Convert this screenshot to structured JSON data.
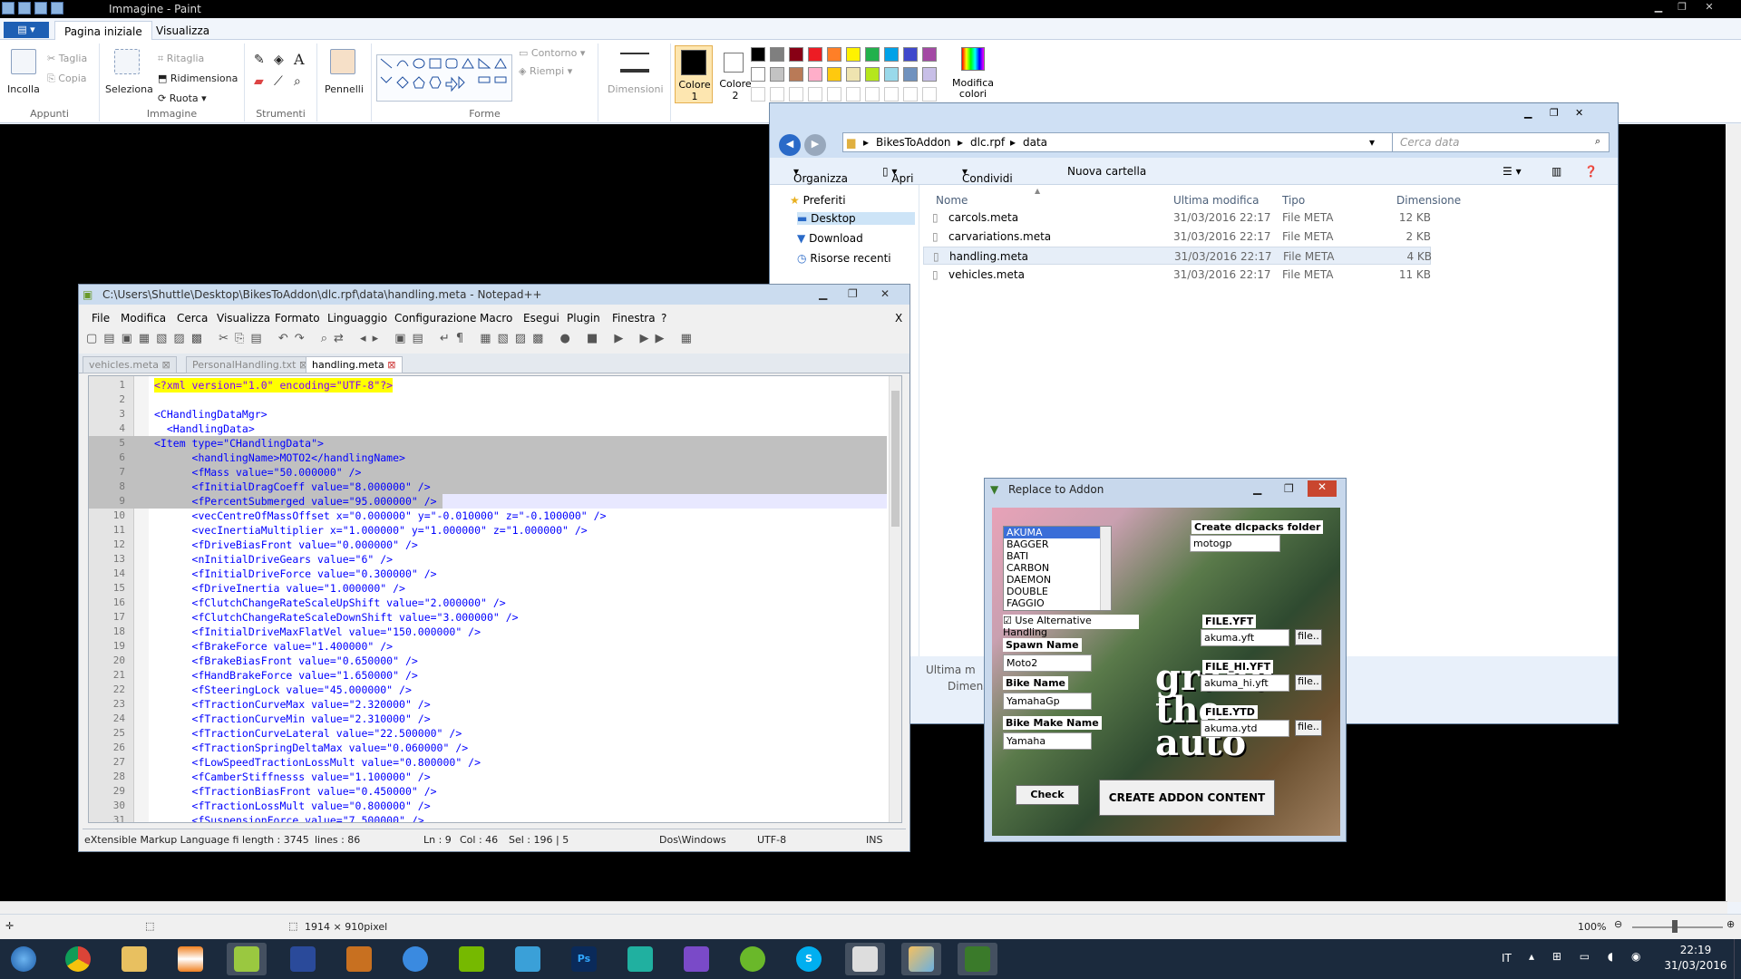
{
  "paint": {
    "title": "Immagine - Paint",
    "tabs": [
      "Pagina iniziale",
      "Visualizza"
    ],
    "groups": {
      "clipboard": {
        "label": "Appunti",
        "paste": "Incolla",
        "cut": "Taglia",
        "copy": "Copia"
      },
      "image": {
        "label": "Immagine",
        "select": "Seleziona",
        "crop": "Ritaglia",
        "resize": "Ridimensiona",
        "rotate": "Ruota"
      },
      "tools": {
        "label": "Strumenti"
      },
      "brushes": {
        "label": "Pennelli"
      },
      "shapes": {
        "label": "Forme",
        "outline": "Contorno",
        "fill": "Riempi"
      },
      "size": {
        "label": "Dimensioni"
      },
      "color1": "Colore 1",
      "color2": "Colore 2",
      "edit_colors": "Modifica colori"
    },
    "palette": [
      "#000000",
      "#7f7f7f",
      "#880015",
      "#ed1c24",
      "#ff7f27",
      "#fff200",
      "#22b14c",
      "#00a2e8",
      "#3f48cc",
      "#a349a4",
      "#ffffff",
      "#c3c3c3",
      "#b97a57",
      "#ffaec9",
      "#ffc90e",
      "#efe4b0",
      "#b5e61d",
      "#99d9ea",
      "#7092be",
      "#c8bfe7"
    ],
    "status": {
      "size": "1914 × 910pixel",
      "zoom": "100%"
    }
  },
  "explorer": {
    "path": [
      "BikesToAddon",
      "dlc.rpf",
      "data"
    ],
    "search_placeholder": "Cerca data",
    "toolbar": [
      "Organizza",
      "Apri",
      "Condividi con",
      "Nuova cartella"
    ],
    "nav": [
      "Preferiti",
      "Desktop",
      "Download",
      "Risorse recenti"
    ],
    "columns": [
      "Nome",
      "Ultima modifica",
      "Tipo",
      "Dimensione"
    ],
    "files": [
      {
        "name": "carcols.meta",
        "date": "31/03/2016 22:17",
        "type": "File META",
        "size": "12 KB"
      },
      {
        "name": "carvariations.meta",
        "date": "31/03/2016 22:17",
        "type": "File META",
        "size": "2 KB"
      },
      {
        "name": "handling.meta",
        "date": "31/03/2016 22:17",
        "type": "File META",
        "size": "4 KB"
      },
      {
        "name": "vehicles.meta",
        "date": "31/03/2016 22:17",
        "type": "File META",
        "size": "11 KB"
      }
    ],
    "details": [
      "Ultima m",
      "Dimensi"
    ]
  },
  "npp": {
    "title": "C:\\Users\\Shuttle\\Desktop\\BikesToAddon\\dlc.rpf\\data\\handling.meta - Notepad++",
    "menu": [
      "File",
      "Modifica",
      "Cerca",
      "Visualizza",
      "Formato",
      "Linguaggio",
      "Configurazione",
      "Macro",
      "Esegui",
      "Plugin",
      "Finestra",
      "?"
    ],
    "close_x": "X",
    "tabs": [
      "vehicles.meta",
      "PersonalHandling.txt",
      "handling.meta"
    ],
    "lines": [
      "<?xml version=\"1.0\" encoding=\"UTF-8\"?>",
      "",
      "<CHandlingDataMgr>",
      "  <HandlingData>",
      "<Item type=\"CHandlingData\">",
      "      <handlingName>MOTO2</handlingName>",
      "      <fMass value=\"50.000000\" />",
      "      <fInitialDragCoeff value=\"8.000000\" />",
      "      <fPercentSubmerged value=\"95.000000\" />",
      "      <vecCentreOfMassOffset x=\"0.000000\" y=\"-0.010000\" z=\"-0.100000\" />",
      "      <vecInertiaMultiplier x=\"1.000000\" y=\"1.000000\" z=\"1.000000\" />",
      "      <fDriveBiasFront value=\"0.000000\" />",
      "      <nInitialDriveGears value=\"6\" />",
      "      <fInitialDriveForce value=\"0.300000\" />",
      "      <fDriveInertia value=\"1.000000\" />",
      "      <fClutchChangeRateScaleUpShift value=\"2.000000\" />",
      "      <fClutchChangeRateScaleDownShift value=\"3.000000\" />",
      "      <fInitialDriveMaxFlatVel value=\"150.000000\" />",
      "      <fBrakeForce value=\"1.400000\" />",
      "      <fBrakeBiasFront value=\"0.650000\" />",
      "      <fHandBrakeForce value=\"1.650000\" />",
      "      <fSteeringLock value=\"45.000000\" />",
      "      <fTractionCurveMax value=\"2.320000\" />",
      "      <fTractionCurveMin value=\"2.310000\" />",
      "      <fTractionCurveLateral value=\"22.500000\" />",
      "      <fTractionSpringDeltaMax value=\"0.060000\" />",
      "      <fLowSpeedTractionLossMult value=\"0.800000\" />",
      "      <fCamberStiffnesss value=\"1.100000\" />",
      "      <fTractionBiasFront value=\"0.450000\" />",
      "      <fTractionLossMult value=\"0.800000\" />",
      "      <fSuspensionForce value=\"7.500000\" />"
    ],
    "status": {
      "lang": "eXtensible Markup Language fi",
      "length": "length : 3745",
      "lines": "lines : 86",
      "ln": "Ln : 9",
      "col": "Col : 46",
      "sel": "Sel : 196 | 5",
      "eol": "Dos\\Windows",
      "enc": "UTF-8",
      "mode": "INS"
    }
  },
  "addon": {
    "title": "Replace to Addon",
    "list": [
      "AKUMA",
      "BAGGER",
      "BATI",
      "CARBON",
      "DAEMON",
      "DOUBLE",
      "FAGGIO"
    ],
    "alt_handling": "Use Alternative Handling",
    "dlcpacks_label": "Create dlcpacks folder",
    "dlcpacks_value": "motogp",
    "spawn_label": "Spawn Name",
    "spawn_value": "Moto2",
    "bike_label": "Bike Name",
    "bike_value": "YamahaGp",
    "make_label": "Bike Make Name",
    "make_value": "Yamaha",
    "yft_label": "FILE.YFT",
    "yft_value": "akuma.yft",
    "hiyft_label": "FILE_HI.YFT",
    "hiyft_value": "akuma_hi.yft",
    "ytd_label": "FILE.YTD",
    "ytd_value": "akuma.ytd",
    "file_btn": "file..",
    "check": "Check",
    "create": "CREATE ADDON CONTENT"
  },
  "taskbar": {
    "lang": "IT",
    "time": "22:19",
    "date": "31/03/2016"
  }
}
